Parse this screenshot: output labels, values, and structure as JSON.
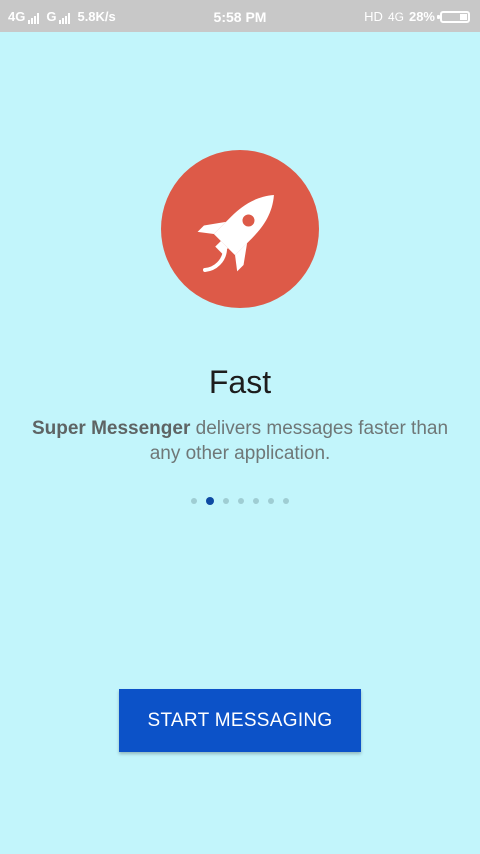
{
  "status_bar": {
    "network_1": "4G",
    "network_2": "G",
    "speed": "5.8K/s",
    "time": "5:58 PM",
    "hd": "HD",
    "network_3": "4G",
    "battery_text": "28%",
    "battery_level": 0.28
  },
  "onboarding": {
    "icon": "rocket-icon",
    "title": "Fast",
    "desc_bold": "Super Messenger",
    "desc_rest": " delivers messages faster than any other application.",
    "page_count": 7,
    "active_page": 2
  },
  "cta": {
    "label": "START MESSAGING"
  },
  "colors": {
    "background": "#c2f5fb",
    "circle": "#dd5a48",
    "button": "#0c52c8",
    "active_dot": "#0d4aa3"
  }
}
